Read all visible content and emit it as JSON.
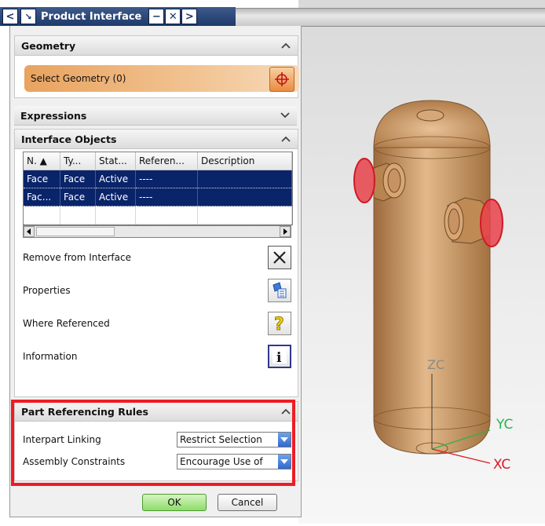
{
  "titlebar": {
    "title": "Product Interface"
  },
  "geometry": {
    "header": "Geometry",
    "select_label": "Select Geometry (0)"
  },
  "expressions": {
    "header": "Expressions"
  },
  "interface_objects": {
    "header": "Interface Objects",
    "columns": [
      "N. ▲",
      "Ty...",
      "Stat...",
      "Referen...",
      "Description"
    ],
    "rows": [
      [
        "Face",
        "Face",
        "Active",
        "----",
        ""
      ],
      [
        "Fac...",
        "Face",
        "Active",
        "----",
        ""
      ]
    ]
  },
  "actions": {
    "remove": "Remove from Interface",
    "properties": "Properties",
    "where_referenced": "Where Referenced",
    "information": "Information"
  },
  "rules": {
    "header": "Part Referencing Rules",
    "interpart_label": "Interpart Linking",
    "interpart_value": "Restrict Selection",
    "assembly_label": "Assembly Constraints",
    "assembly_value": "Encourage Use of"
  },
  "buttons": {
    "ok": "OK",
    "cancel": "Cancel"
  },
  "axes": {
    "z": "ZC",
    "y": "YC",
    "x": "XC"
  },
  "colors": {
    "selection": "#0a246a",
    "highlight": "#ee1c24",
    "model": "#c8955d",
    "face_highlight": "#e8424b"
  }
}
